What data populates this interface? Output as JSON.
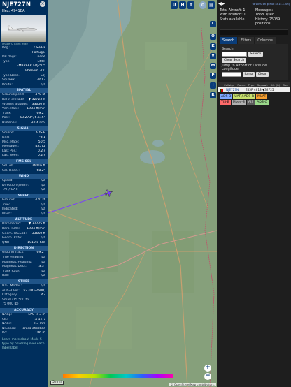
{
  "aircraft": {
    "callsign": "NJE727N",
    "hex": "Hex: 4941BA",
    "photo_credit": "Image © Björn Huke",
    "close_symbol": "×"
  },
  "general": [
    {
      "k": "Reg.:",
      "v": "CS-PHF"
    },
    {
      "k": "",
      "v": "Portugal"
    },
    {
      "k": "DB flags:",
      "v": "none"
    },
    {
      "k": "Type:",
      "v": "E55P"
    },
    {
      "k": "",
      "v": "EMBRAER ERJ-505"
    },
    {
      "k": "",
      "v": "Phenom 300"
    },
    {
      "k": "Type Desc.:",
      "v": "L2J"
    },
    {
      "k": "Squawk:",
      "v": "4613"
    },
    {
      "k": "Route:",
      "v": "n/a"
    }
  ],
  "sections": {
    "spatial": "SPATIAL",
    "signal": "SIGNAL",
    "fms": "FMS SEL",
    "wind": "WIND",
    "speed": "SPEED",
    "altitude": "ALTITUDE",
    "direction": "DIRECTION",
    "stuff": "STUFF",
    "accuracy": "ACCURACY"
  },
  "spatial": [
    {
      "k": "Groundspeed:",
      "v": "470 kt"
    },
    {
      "k": "Baro. altitude:",
      "v": "▼ 32725 ft"
    },
    {
      "k": "WGS84 altitude:",
      "v": "33650 ft"
    },
    {
      "k": "Vert. Rate:",
      "v": "-1984 ft/min"
    },
    {
      "k": "Track:",
      "v": "69.2°"
    },
    {
      "k": "Pos.:",
      "v": "53.273°, 6.615°"
    },
    {
      "k": "Distance:",
      "v": "32.4 nmi"
    }
  ],
  "signal": [
    {
      "k": "Source:",
      "v": "ADS-B"
    },
    {
      "k": "RSSI:",
      "v": "-3.1"
    },
    {
      "k": "Msg. Rate:",
      "v": "50.5"
    },
    {
      "k": "Messages:",
      "v": "45572"
    },
    {
      "k": "Last Pos.:",
      "v": "0.2 s"
    },
    {
      "k": "Last Seen:",
      "v": "0.2 s"
    }
  ],
  "fms": [
    {
      "k": "Sel. Alt.:",
      "v": "26016 ft"
    },
    {
      "k": "Sel. Head.:",
      "v": "68.2°"
    }
  ],
  "wind": [
    {
      "k": "Speed:",
      "v": "n/a"
    },
    {
      "k": "Direction (from):",
      "v": "n/a"
    },
    {
      "k": "TAT / OAT:",
      "v": "n/a"
    }
  ],
  "speed": [
    {
      "k": "Ground:",
      "v": "470 kt"
    },
    {
      "k": "True:",
      "v": "n/a"
    },
    {
      "k": "Indicated:",
      "v": "n/a"
    },
    {
      "k": "Mach:",
      "v": "n/a"
    }
  ],
  "altitude": [
    {
      "k": "Barometric:",
      "v": "▼ 32725 ft"
    },
    {
      "k": "Baro. Rate:",
      "v": "-1984 ft/min"
    },
    {
      "k": "Geom. WGS84:",
      "v": "33650 ft"
    },
    {
      "k": "Geom. Rate:",
      "v": "n/a"
    },
    {
      "k": "QNH:",
      "v": "1012.8 hPa"
    }
  ],
  "direction": [
    {
      "k": "Ground Track:",
      "v": "69.2°"
    },
    {
      "k": "True Heading:",
      "v": "n/a"
    },
    {
      "k": "Magnetic Heading:",
      "v": "n/a"
    },
    {
      "k": "Magnetic Decl.:",
      "v": "3.3°"
    },
    {
      "k": "Track Rate:",
      "v": "n/a"
    },
    {
      "k": "Roll:",
      "v": "n/a"
    }
  ],
  "stuff": [
    {
      "k": "Nav. Modes:",
      "v": "n/a"
    },
    {
      "k": "ADS-B Ver.:",
      "v": "v2 (DO-260B)"
    },
    {
      "k": "Category:",
      "v": "A2"
    },
    {
      "k": "Small (15 500 to",
      "v": ""
    },
    {
      "k": "75 000 lb)",
      "v": ""
    }
  ],
  "accuracy": [
    {
      "k": "NACp:",
      "v": "EPU < 3 m"
    },
    {
      "k": "SIL:",
      "v": "≤ 1e-7"
    },
    {
      "k": "NACv:",
      "v": "< 3 m/s"
    },
    {
      "k": "NICbaro:",
      "v": "cross-checked"
    },
    {
      "k": "Rc:",
      "v": "186 m"
    }
  ],
  "footer": "Learn more about Mode S type by hovering over each label label",
  "map": {
    "top_buttons": [
      "U",
      "H",
      "T"
    ],
    "side_buttons": [
      "L",
      "O",
      "K",
      "V",
      "M",
      "P",
      "I",
      "R"
    ],
    "zoom_in": "+",
    "zoom_out": "−",
    "scale_label": "5 nmi",
    "attribution": "© OpenStreetMap contributors."
  },
  "sidebar": {
    "version": "tar1090 on github (3.14.1706)",
    "total_aircraft": "Total Aircraft: 1",
    "with_position": "With Position: 1",
    "stats_available": "Stats available",
    "messages": "Messages: 1868.7/sec",
    "history": "History: 25039 positions",
    "tabs": [
      "Search",
      "Filters",
      "Columns"
    ],
    "search_label": "Search:",
    "search_button": "Search",
    "clear_search": "Clear Search",
    "jump_label": "Jump to Airport or Latitude, Longitude:",
    "jump_button": "Jump",
    "clear_button": "Clear",
    "table_headers": [
      "Callsign",
      "Route",
      "Type",
      "Squawk",
      "Alt. (ft)",
      "Spd"
    ],
    "table_row": {
      "callsign": "NJE727N",
      "route": "",
      "type": "E55P",
      "squawk": "4613",
      "alt": "▼32725"
    },
    "legend": [
      {
        "label": "ADS-B",
        "color": "#7ea7ff"
      },
      {
        "label": "UAT / ADS-R",
        "color": "#c8e06e"
      },
      {
        "label": "MLAT",
        "color": "#f8a030"
      },
      {
        "label": "TIS-B",
        "color": "#ff6a6a"
      },
      {
        "label": "Mode-S",
        "color": "#b0b0b0"
      },
      {
        "label": "AIS",
        "color": "#5a5a5a"
      },
      {
        "label": "ADS-C",
        "color": "#9ad88a"
      }
    ]
  }
}
